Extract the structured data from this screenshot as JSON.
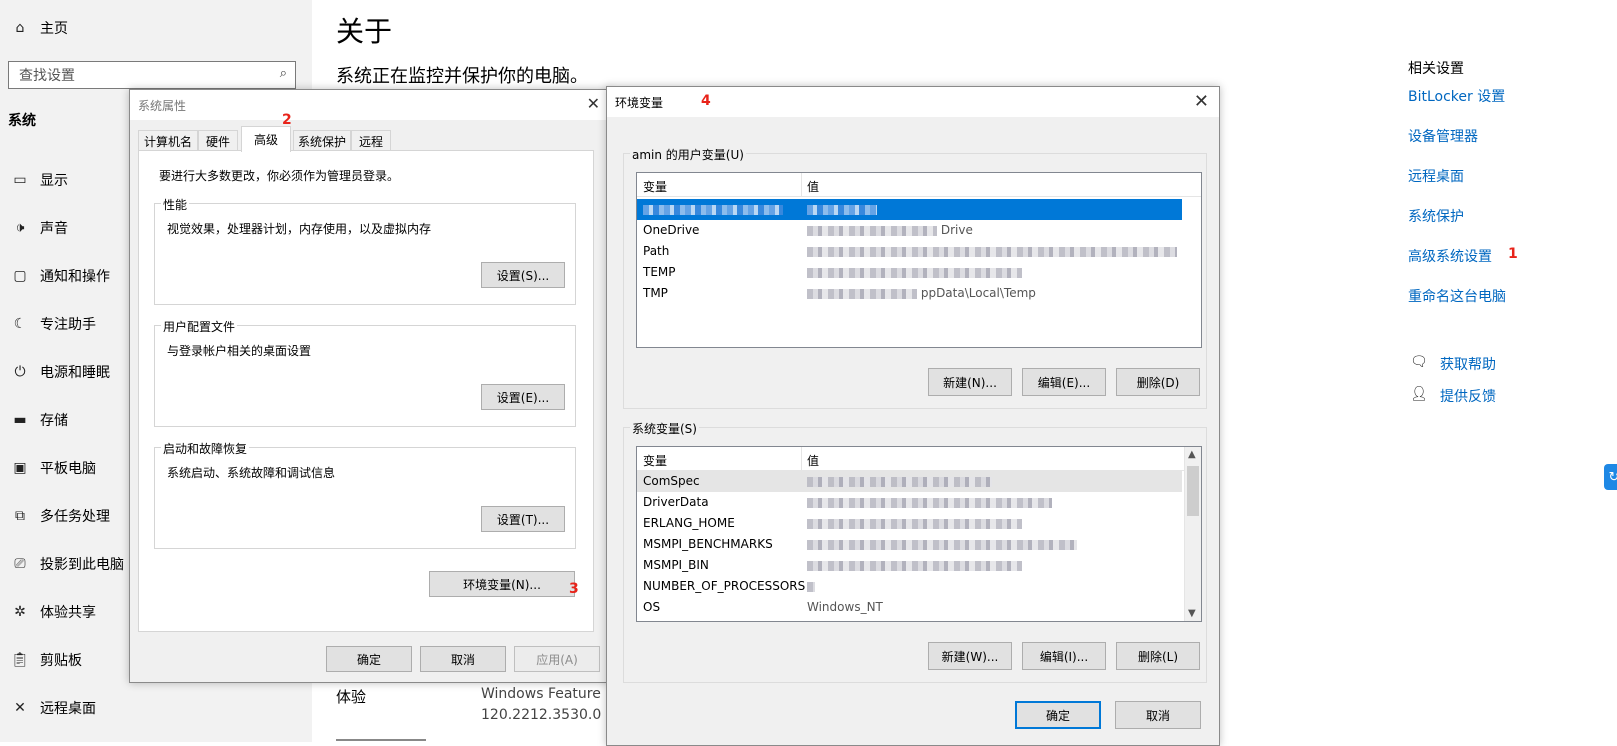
{
  "sidebar": {
    "home_label": "主页",
    "search_placeholder": "查找设置",
    "section_label": "系统",
    "items": [
      {
        "label": "显示",
        "icon": "display-icon"
      },
      {
        "label": "声音",
        "icon": "speaker-icon"
      },
      {
        "label": "通知和操作",
        "icon": "notification-icon"
      },
      {
        "label": "专注助手",
        "icon": "moon-icon"
      },
      {
        "label": "电源和睡眠",
        "icon": "power-icon"
      },
      {
        "label": "存储",
        "icon": "storage-icon"
      },
      {
        "label": "平板电脑",
        "icon": "tablet-icon"
      },
      {
        "label": "多任务处理",
        "icon": "multitask-icon"
      },
      {
        "label": "投影到此电脑",
        "icon": "project-icon"
      },
      {
        "label": "体验共享",
        "icon": "share-icon"
      },
      {
        "label": "剪贴板",
        "icon": "clipboard-icon"
      },
      {
        "label": "远程桌面",
        "icon": "remote-icon"
      }
    ]
  },
  "about": {
    "title": "关于",
    "subtitle": "系统正在监控并保护你的电脑。",
    "experience_label": "体验",
    "experience_value1": "Windows Feature Ex",
    "experience_value2": "120.2212.3530.0"
  },
  "related": {
    "heading": "相关设置",
    "links": [
      "BitLocker 设置",
      "设备管理器",
      "远程桌面",
      "系统保护",
      "高级系统设置",
      "重命名这台电脑"
    ],
    "help": "获取帮助",
    "feedback": "提供反馈"
  },
  "annotations": {
    "n1": "1",
    "n2": "2",
    "n3": "3",
    "n4": "4"
  },
  "system_properties": {
    "title": "系统属性",
    "tabs": [
      "计算机名",
      "硬件",
      "高级",
      "系统保护",
      "远程"
    ],
    "active_tab": "高级",
    "admin_note": "要进行大多数更改，你必须作为管理员登录。",
    "performance": {
      "label": "性能",
      "desc": "视觉效果，处理器计划，内存使用，以及虚拟内存",
      "button": "设置(S)..."
    },
    "user_profiles": {
      "label": "用户配置文件",
      "desc": "与登录帐户相关的桌面设置",
      "button": "设置(E)..."
    },
    "startup": {
      "label": "启动和故障恢复",
      "desc": "系统启动、系统故障和调试信息",
      "button": "设置(T)..."
    },
    "env_button": "环境变量(N)...",
    "ok": "确定",
    "cancel": "取消",
    "apply": "应用(A)"
  },
  "env_vars": {
    "title": "环境变量",
    "user_group": "amin 的用户变量(U)",
    "system_group": "系统变量(S)",
    "col_name": "变量",
    "col_value": "值",
    "user_rows": [
      {
        "name": "",
        "value": ""
      },
      {
        "name": "OneDrive",
        "value": "Drive"
      },
      {
        "name": "Path",
        "value": ""
      },
      {
        "name": "TEMP",
        "value": ""
      },
      {
        "name": "TMP",
        "value": "ppData\\Local\\Temp"
      }
    ],
    "system_rows": [
      {
        "name": "ComSpec",
        "value": ""
      },
      {
        "name": "DriverData",
        "value": ""
      },
      {
        "name": "ERLANG_HOME",
        "value": ""
      },
      {
        "name": "MSMPI_BENCHMARKS",
        "value": ""
      },
      {
        "name": "MSMPI_BIN",
        "value": ""
      },
      {
        "name": "NUMBER_OF_PROCESSORS",
        "value": ""
      },
      {
        "name": "OS",
        "value": "Windows_NT"
      }
    ],
    "user_buttons": [
      "新建(N)...",
      "编辑(E)...",
      "删除(D)"
    ],
    "system_buttons": [
      "新建(W)...",
      "编辑(I)...",
      "删除(L)"
    ],
    "ok": "确定",
    "cancel": "取消"
  }
}
